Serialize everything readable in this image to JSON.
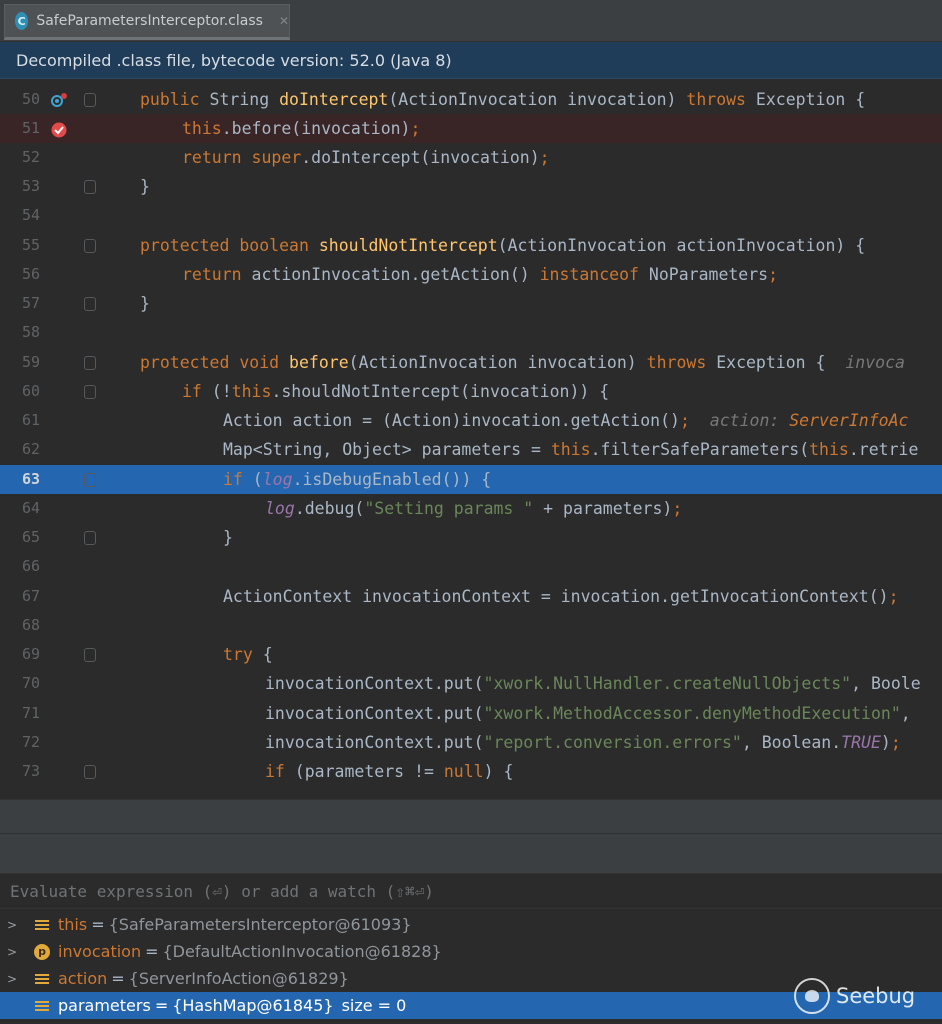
{
  "tab": {
    "label": "SafeParametersInterceptor.class",
    "icon": "class-file-icon"
  },
  "banner": {
    "text": "Decompiled .class file, bytecode version: 52.0 (Java 8)"
  },
  "lines": [
    {
      "n": "50"
    },
    {
      "n": "51"
    },
    {
      "n": "52"
    },
    {
      "n": "53"
    },
    {
      "n": "54"
    },
    {
      "n": "55"
    },
    {
      "n": "56"
    },
    {
      "n": "57"
    },
    {
      "n": "58"
    },
    {
      "n": "59"
    },
    {
      "n": "60"
    },
    {
      "n": "61"
    },
    {
      "n": "62"
    },
    {
      "n": "63"
    },
    {
      "n": "64"
    },
    {
      "n": "65"
    },
    {
      "n": "66"
    },
    {
      "n": "67"
    },
    {
      "n": "68"
    },
    {
      "n": "69"
    },
    {
      "n": "70"
    },
    {
      "n": "71"
    },
    {
      "n": "72"
    },
    {
      "n": "73"
    }
  ],
  "code": {
    "l50": [
      "public",
      " String ",
      "doIntercept",
      "(ActionInvocation invocation) ",
      "throws",
      " Exception {"
    ],
    "l51": [
      "this",
      ".before(invocation)",
      ";"
    ],
    "l52": [
      "return",
      " ",
      "super",
      ".doIntercept(invocation)",
      ";"
    ],
    "l53": [
      "}"
    ],
    "l55": [
      "protected",
      " ",
      "boolean",
      " ",
      "shouldNotIntercept",
      "(ActionInvocation actionInvocation) {"
    ],
    "l56": [
      "return",
      " actionInvocation.getAction() ",
      "instanceof",
      " NoParameters",
      ";"
    ],
    "l57": [
      "}"
    ],
    "l59": [
      "protected",
      " ",
      "void",
      " ",
      "before",
      "(ActionInvocation invocation) ",
      "throws",
      " Exception {  ",
      "invoca"
    ],
    "l60": [
      "if",
      " (!",
      "this",
      ".shouldNotIntercept(invocation)) {"
    ],
    "l61": [
      "Action action = (Action)invocation.getAction()",
      ";",
      "  action: ",
      "ServerInfoAc"
    ],
    "l62": [
      "Map<String, Object> parameters = ",
      "this",
      ".filterSafeParameters(",
      "this",
      ".retrie"
    ],
    "l63": [
      "if",
      " (",
      "log",
      ".isDebugEnabled()) {"
    ],
    "l64": [
      "log",
      ".debug(",
      "\"Setting params \"",
      " + parameters)",
      ";"
    ],
    "l65": [
      "}"
    ],
    "l67": [
      "ActionContext invocationContext = invocation.getInvocationContext()",
      ";"
    ],
    "l69": [
      "try",
      " {"
    ],
    "l70": [
      "invocationContext.put(",
      "\"xwork.NullHandler.createNullObjects\"",
      ", Boole"
    ],
    "l71": [
      "invocationContext.put(",
      "\"xwork.MethodAccessor.denyMethodExecution\"",
      ","
    ],
    "l72": [
      "invocationContext.put(",
      "\"report.conversion.errors\"",
      ", Boolean.",
      "TRUE",
      ")",
      ";"
    ],
    "l73": [
      "if",
      " (parameters != ",
      "null",
      ") {"
    ]
  },
  "evaluate": {
    "placeholder": "Evaluate expression (⏎) or add a watch (⇧⌘⏎)"
  },
  "variables": [
    {
      "name": "this",
      "value": "{SafeParametersInterceptor@61093}",
      "icon": "field-list-icon"
    },
    {
      "name": "invocation",
      "value": "{DefaultActionInvocation@61828}",
      "icon": "parameter-icon"
    },
    {
      "name": "action",
      "value": "{ServerInfoAction@61829}",
      "icon": "field-list-icon"
    },
    {
      "name": "parameters",
      "value": "{HashMap@61845}",
      "size": "size = 0",
      "icon": "field-list-icon"
    }
  ],
  "watermark": {
    "text": "Seebug"
  },
  "colors": {
    "keyword": "#cc7832",
    "function": "#ffc66d",
    "string": "#6a8759",
    "field": "#9876aa",
    "selection": "#2467b0",
    "breakpoint_line": "#3a2526"
  }
}
